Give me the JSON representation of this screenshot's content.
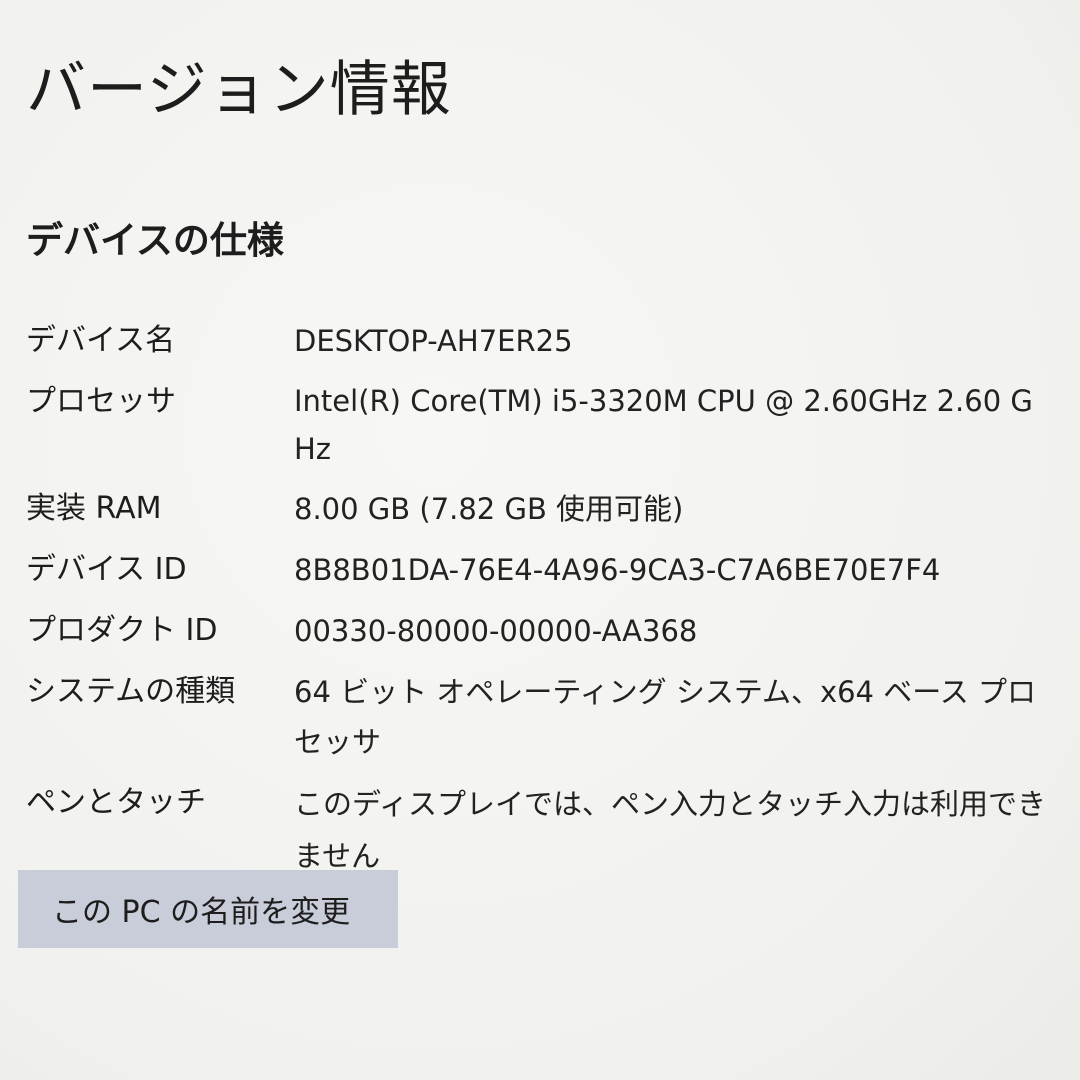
{
  "page": {
    "title": "バージョン情報"
  },
  "device_specs": {
    "heading": "デバイスの仕様",
    "rows": [
      {
        "label": "デバイス名",
        "value": "DESKTOP-AH7ER25"
      },
      {
        "label": "プロセッサ",
        "value": "Intel(R) Core(TM) i5-3320M CPU @ 2.60GHz   2.60 GHz"
      },
      {
        "label": "実装 RAM",
        "value": "8.00 GB (7.82 GB 使用可能)"
      },
      {
        "label": "デバイス ID",
        "value": "8B8B01DA-76E4-4A96-9CA3-C7A6BE70E7F4"
      },
      {
        "label": "プロダクト ID",
        "value": "00330-80000-00000-AA368"
      },
      {
        "label": "システムの種類",
        "value": "64 ビット オペレーティング システム、x64 ベース プロセッサ"
      },
      {
        "label": "ペンとタッチ",
        "value": "このディスプレイでは、ペン入力とタッチ入力は利用できません"
      }
    ],
    "rename_button_label": "この PC の名前を変更"
  },
  "colors": {
    "background": "#f3f3f1",
    "text": "#1d1d1d",
    "button_background": "#c9ccd9"
  }
}
